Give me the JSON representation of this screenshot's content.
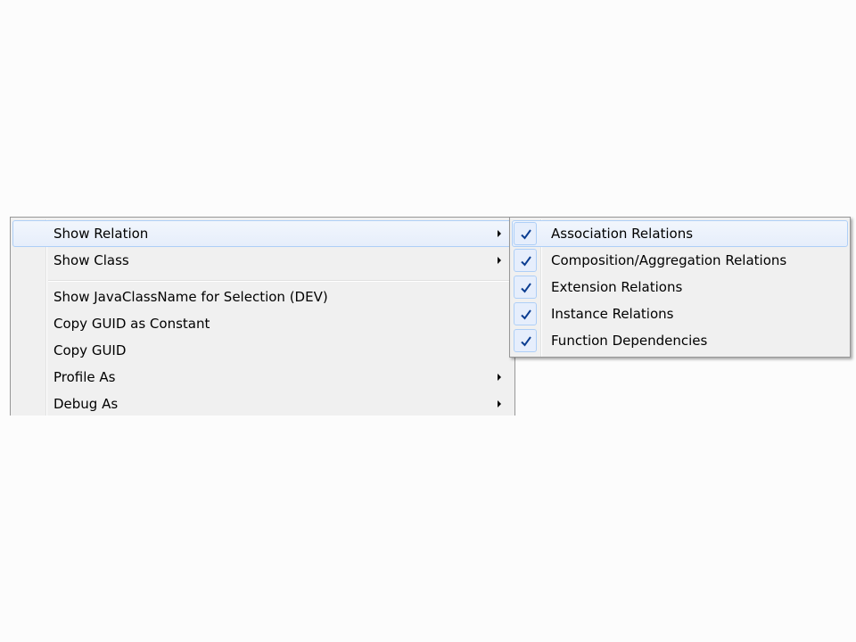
{
  "context_menu": {
    "items": [
      {
        "label": "Show Relation",
        "has_submenu": true,
        "highlighted": true
      },
      {
        "label": "Show Class",
        "has_submenu": true,
        "highlighted": false
      },
      {
        "label": "Show JavaClassName for Selection (DEV)",
        "has_submenu": false,
        "highlighted": false
      },
      {
        "label": "Copy GUID as Constant",
        "has_submenu": false,
        "highlighted": false
      },
      {
        "label": "Copy GUID",
        "has_submenu": false,
        "highlighted": false
      },
      {
        "label": "Profile As",
        "has_submenu": true,
        "highlighted": false
      },
      {
        "label": "Debug As",
        "has_submenu": true,
        "highlighted": false
      }
    ]
  },
  "submenu": {
    "items": [
      {
        "label": "Association Relations",
        "checked": true,
        "highlighted": true
      },
      {
        "label": "Composition/Aggregation Relations",
        "checked": true,
        "highlighted": false
      },
      {
        "label": "Extension Relations",
        "checked": true,
        "highlighted": false
      },
      {
        "label": "Instance Relations",
        "checked": true,
        "highlighted": false
      },
      {
        "label": "Function Dependencies",
        "checked": true,
        "highlighted": false
      }
    ]
  },
  "colors": {
    "menu_background": "#f0f0f0",
    "highlight_border": "#aecff7",
    "checkmark": "#0b3d91"
  },
  "icons": {
    "submenu_arrow": "chevron-right-icon",
    "check": "checkmark-icon"
  }
}
